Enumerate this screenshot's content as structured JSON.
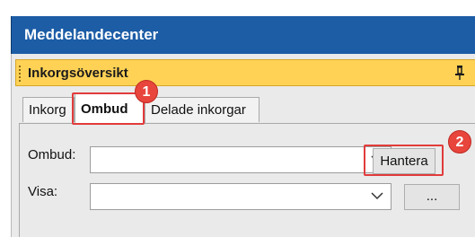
{
  "window": {
    "title": "Meddelandecenter"
  },
  "panel": {
    "header": "Inkorgsöversikt",
    "pin_icon": "pin-icon"
  },
  "tabs": [
    {
      "label": "Inkorg"
    },
    {
      "label": "Ombud",
      "active": true
    },
    {
      "label": "Delade inkorgar"
    }
  ],
  "form": {
    "ombud_label": "Ombud:",
    "ombud_value": "",
    "hantera_button": "Hantera",
    "visa_label": "Visa:",
    "visa_value": "",
    "more_button": "..."
  },
  "annotations": {
    "marker_1": "1",
    "marker_2": "2",
    "color": "#e23b3b"
  },
  "colors": {
    "titlebar": "#1c5da6",
    "panel_header": "#ffd256",
    "accent": "#e8453c"
  }
}
